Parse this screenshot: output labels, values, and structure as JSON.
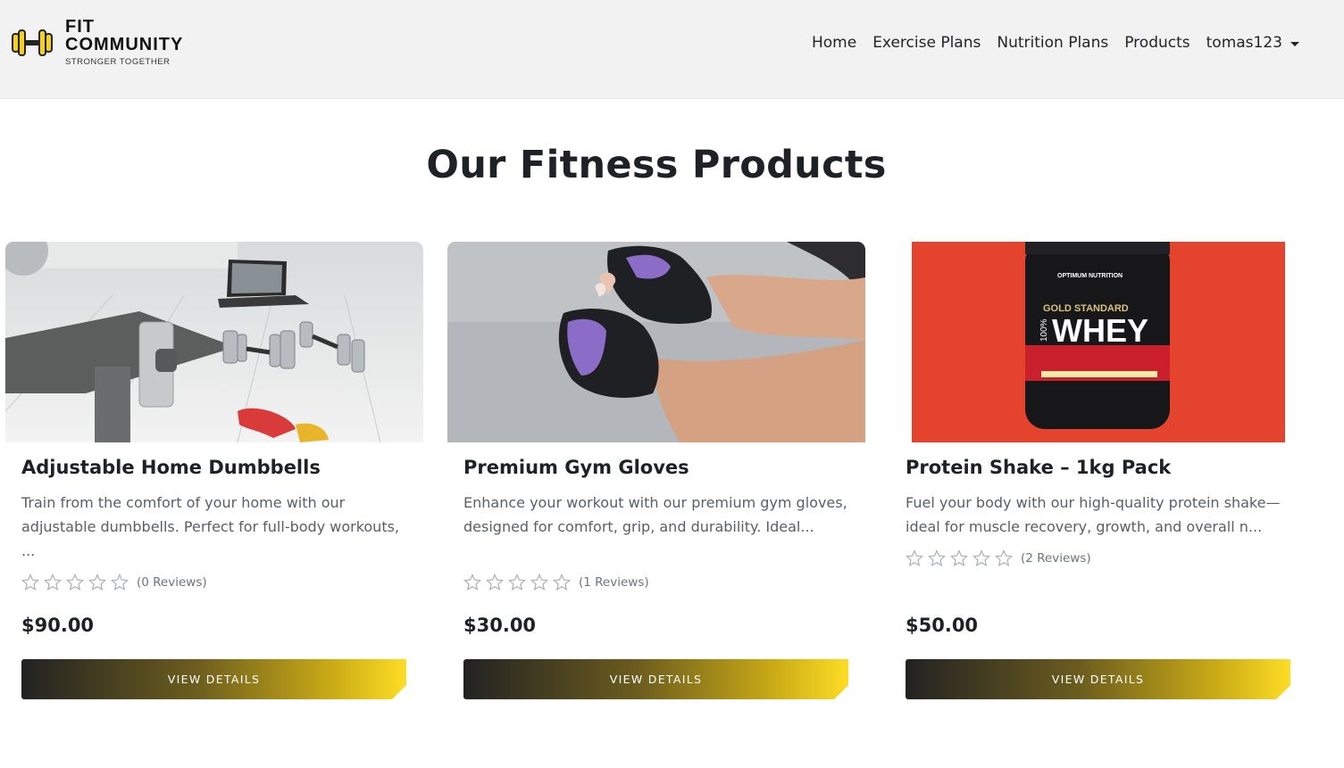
{
  "brand": {
    "line1": "FIT",
    "line2": "COMMUNITY",
    "tagline": "STRONGER TOGETHER",
    "accent": "#f5d020"
  },
  "nav": {
    "items": [
      "Home",
      "Exercise Plans",
      "Nutrition Plans",
      "Products"
    ],
    "user": "tomas123"
  },
  "page": {
    "title": "Our Fitness Products"
  },
  "products": [
    {
      "title": "Adjustable Home Dumbbells",
      "description": "Train from the comfort of your home with our adjustable dumbbells. Perfect for full-body workouts, ...",
      "rating": 0,
      "reviews": "(0 Reviews)",
      "price": "$90.00",
      "button": "VIEW DETAILS",
      "image": "dumbbells-photo"
    },
    {
      "title": "Premium Gym Gloves",
      "description": "Enhance your workout with our premium gym gloves, designed for comfort, grip, and durability. Ideal...",
      "rating": 0,
      "reviews": "(1 Reviews)",
      "price": "$30.00",
      "button": "VIEW DETAILS",
      "image": "gloves-photo"
    },
    {
      "title": "Protein Shake – 1kg Pack",
      "description": "Fuel your body with our high-quality protein shake—ideal for muscle recovery, growth, and overall n...",
      "rating": 0,
      "reviews": "(2 Reviews)",
      "price": "$50.00",
      "button": "VIEW DETAILS",
      "image": "protein-tub-photo",
      "product_label": {
        "brand": "OPTIMUM NUTRITION",
        "line1": "GOLD STANDARD",
        "line2": "100%",
        "line3": "WHEY"
      }
    }
  ]
}
